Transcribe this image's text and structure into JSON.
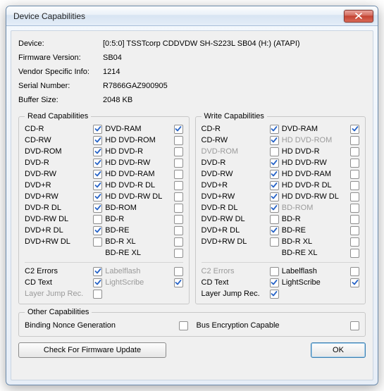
{
  "window": {
    "title": "Device Capabilities"
  },
  "icons": {
    "close": "close-icon"
  },
  "info": {
    "device_label": "Device:",
    "device_value": "[0:5:0] TSSTcorp CDDVDW SH-S223L SB04 (H:) (ATAPI)",
    "firmware_label": "Firmware Version:",
    "firmware_value": "SB04",
    "vendor_label": "Vendor Specific Info:",
    "vendor_value": "1214",
    "serial_label": "Serial Number:",
    "serial_value": "R7866GAZ900905",
    "buffer_label": "Buffer Size:",
    "buffer_value": "2048 KB"
  },
  "read": {
    "legend": "Read Capabilities",
    "col1": [
      {
        "label": "CD-R",
        "checked": true,
        "disabled": false
      },
      {
        "label": "CD-RW",
        "checked": true,
        "disabled": false
      },
      {
        "label": "DVD-ROM",
        "checked": true,
        "disabled": false
      },
      {
        "label": "DVD-R",
        "checked": true,
        "disabled": false
      },
      {
        "label": "DVD-RW",
        "checked": true,
        "disabled": false
      },
      {
        "label": "DVD+R",
        "checked": true,
        "disabled": false
      },
      {
        "label": "DVD+RW",
        "checked": true,
        "disabled": false
      },
      {
        "label": "DVD-R DL",
        "checked": true,
        "disabled": false
      },
      {
        "label": "DVD-RW DL",
        "checked": false,
        "disabled": false
      },
      {
        "label": "DVD+R DL",
        "checked": true,
        "disabled": false
      },
      {
        "label": "DVD+RW DL",
        "checked": false,
        "disabled": false
      }
    ],
    "col2": [
      {
        "label": "DVD-RAM",
        "checked": true,
        "disabled": false
      },
      {
        "label": "HD DVD-ROM",
        "checked": false,
        "disabled": false
      },
      {
        "label": "HD DVD-R",
        "checked": false,
        "disabled": false
      },
      {
        "label": "HD DVD-RW",
        "checked": false,
        "disabled": false
      },
      {
        "label": "HD DVD-RAM",
        "checked": false,
        "disabled": false
      },
      {
        "label": "HD DVD-R DL",
        "checked": false,
        "disabled": false
      },
      {
        "label": "HD DVD-RW DL",
        "checked": false,
        "disabled": false
      },
      {
        "label": "BD-ROM",
        "checked": false,
        "disabled": false
      },
      {
        "label": "BD-R",
        "checked": false,
        "disabled": false
      },
      {
        "label": "BD-RE",
        "checked": false,
        "disabled": false
      },
      {
        "label": "BD-R XL",
        "checked": false,
        "disabled": false
      },
      {
        "label": "BD-RE XL",
        "checked": false,
        "disabled": false
      }
    ],
    "extras": [
      {
        "label1": "C2 Errors",
        "checked1": true,
        "disabled1": false,
        "label2": "Labelflash",
        "checked2": false,
        "disabled2": true
      },
      {
        "label1": "CD Text",
        "checked1": true,
        "disabled1": false,
        "label2": "LightScribe",
        "checked2": true,
        "disabled2": true
      },
      {
        "label1": "Layer Jump Rec.",
        "checked1": false,
        "disabled1": true,
        "label2": "",
        "checked2": false,
        "disabled2": true,
        "empty2": true
      }
    ]
  },
  "write": {
    "legend": "Write Capabilities",
    "col1": [
      {
        "label": "CD-R",
        "checked": true,
        "disabled": false
      },
      {
        "label": "CD-RW",
        "checked": true,
        "disabled": false
      },
      {
        "label": "DVD-ROM",
        "checked": false,
        "disabled": true
      },
      {
        "label": "DVD-R",
        "checked": true,
        "disabled": false
      },
      {
        "label": "DVD-RW",
        "checked": true,
        "disabled": false
      },
      {
        "label": "DVD+R",
        "checked": true,
        "disabled": false
      },
      {
        "label": "DVD+RW",
        "checked": true,
        "disabled": false
      },
      {
        "label": "DVD-R DL",
        "checked": true,
        "disabled": false
      },
      {
        "label": "DVD-RW DL",
        "checked": false,
        "disabled": false
      },
      {
        "label": "DVD+R DL",
        "checked": true,
        "disabled": false
      },
      {
        "label": "DVD+RW DL",
        "checked": false,
        "disabled": false
      }
    ],
    "col2": [
      {
        "label": "DVD-RAM",
        "checked": true,
        "disabled": false
      },
      {
        "label": "HD DVD-ROM",
        "checked": false,
        "disabled": true
      },
      {
        "label": "HD DVD-R",
        "checked": false,
        "disabled": false
      },
      {
        "label": "HD DVD-RW",
        "checked": false,
        "disabled": false
      },
      {
        "label": "HD DVD-RAM",
        "checked": false,
        "disabled": false
      },
      {
        "label": "HD DVD-R DL",
        "checked": false,
        "disabled": false
      },
      {
        "label": "HD DVD-RW DL",
        "checked": false,
        "disabled": false
      },
      {
        "label": "BD-ROM",
        "checked": false,
        "disabled": true
      },
      {
        "label": "BD-R",
        "checked": false,
        "disabled": false
      },
      {
        "label": "BD-RE",
        "checked": false,
        "disabled": false
      },
      {
        "label": "BD-R XL",
        "checked": false,
        "disabled": false
      },
      {
        "label": "BD-RE XL",
        "checked": false,
        "disabled": false
      }
    ],
    "extras": [
      {
        "label1": "C2 Errors",
        "checked1": false,
        "disabled1": true,
        "label2": "Labelflash",
        "checked2": false,
        "disabled2": false
      },
      {
        "label1": "CD Text",
        "checked1": true,
        "disabled1": false,
        "label2": "LightScribe",
        "checked2": true,
        "disabled2": false
      },
      {
        "label1": "Layer Jump Rec.",
        "checked1": true,
        "disabled1": false,
        "label2": "",
        "checked2": false,
        "disabled2": true,
        "empty2": true
      }
    ]
  },
  "other": {
    "legend": "Other Capabilities",
    "items": [
      {
        "label": "Binding Nonce Generation",
        "checked": false
      },
      {
        "label": "Bus Encryption Capable",
        "checked": false
      }
    ]
  },
  "buttons": {
    "firmware": "Check For Firmware Update",
    "ok": "OK"
  }
}
